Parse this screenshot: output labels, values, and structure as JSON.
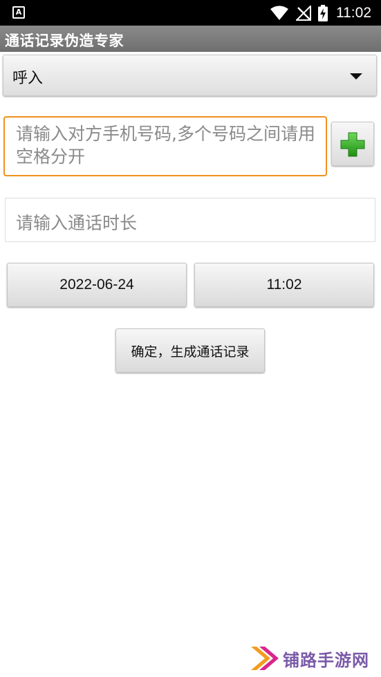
{
  "status_bar": {
    "app_icon_letter": "A",
    "time": "11:02",
    "icons": [
      "wifi-icon",
      "no-signal-icon",
      "battery-charging-icon"
    ]
  },
  "app": {
    "title": "通话记录伪造专家"
  },
  "form": {
    "call_type": {
      "selected": "呼入"
    },
    "phone_input": {
      "value": "",
      "placeholder": "请输入对方手机号码,多个号码之间请用空格分开"
    },
    "add_button": {
      "icon": "plus-icon"
    },
    "duration_input": {
      "value": "",
      "placeholder": "请输入通话时长"
    },
    "date_button": {
      "label": "2022-06-24"
    },
    "time_button": {
      "label": "11:02"
    },
    "confirm_button": {
      "label": "确定，生成通话记录"
    }
  },
  "watermark": {
    "text": "铺路手游网",
    "colors": {
      "text": "#7a5aa8",
      "chevron_primary": "#d8268a",
      "chevron_secondary": "#f29c1f"
    }
  },
  "colors": {
    "focus_border": "#f0901c",
    "title_bar": "#7c7c7c",
    "plus_icon": "#2fae1f"
  }
}
